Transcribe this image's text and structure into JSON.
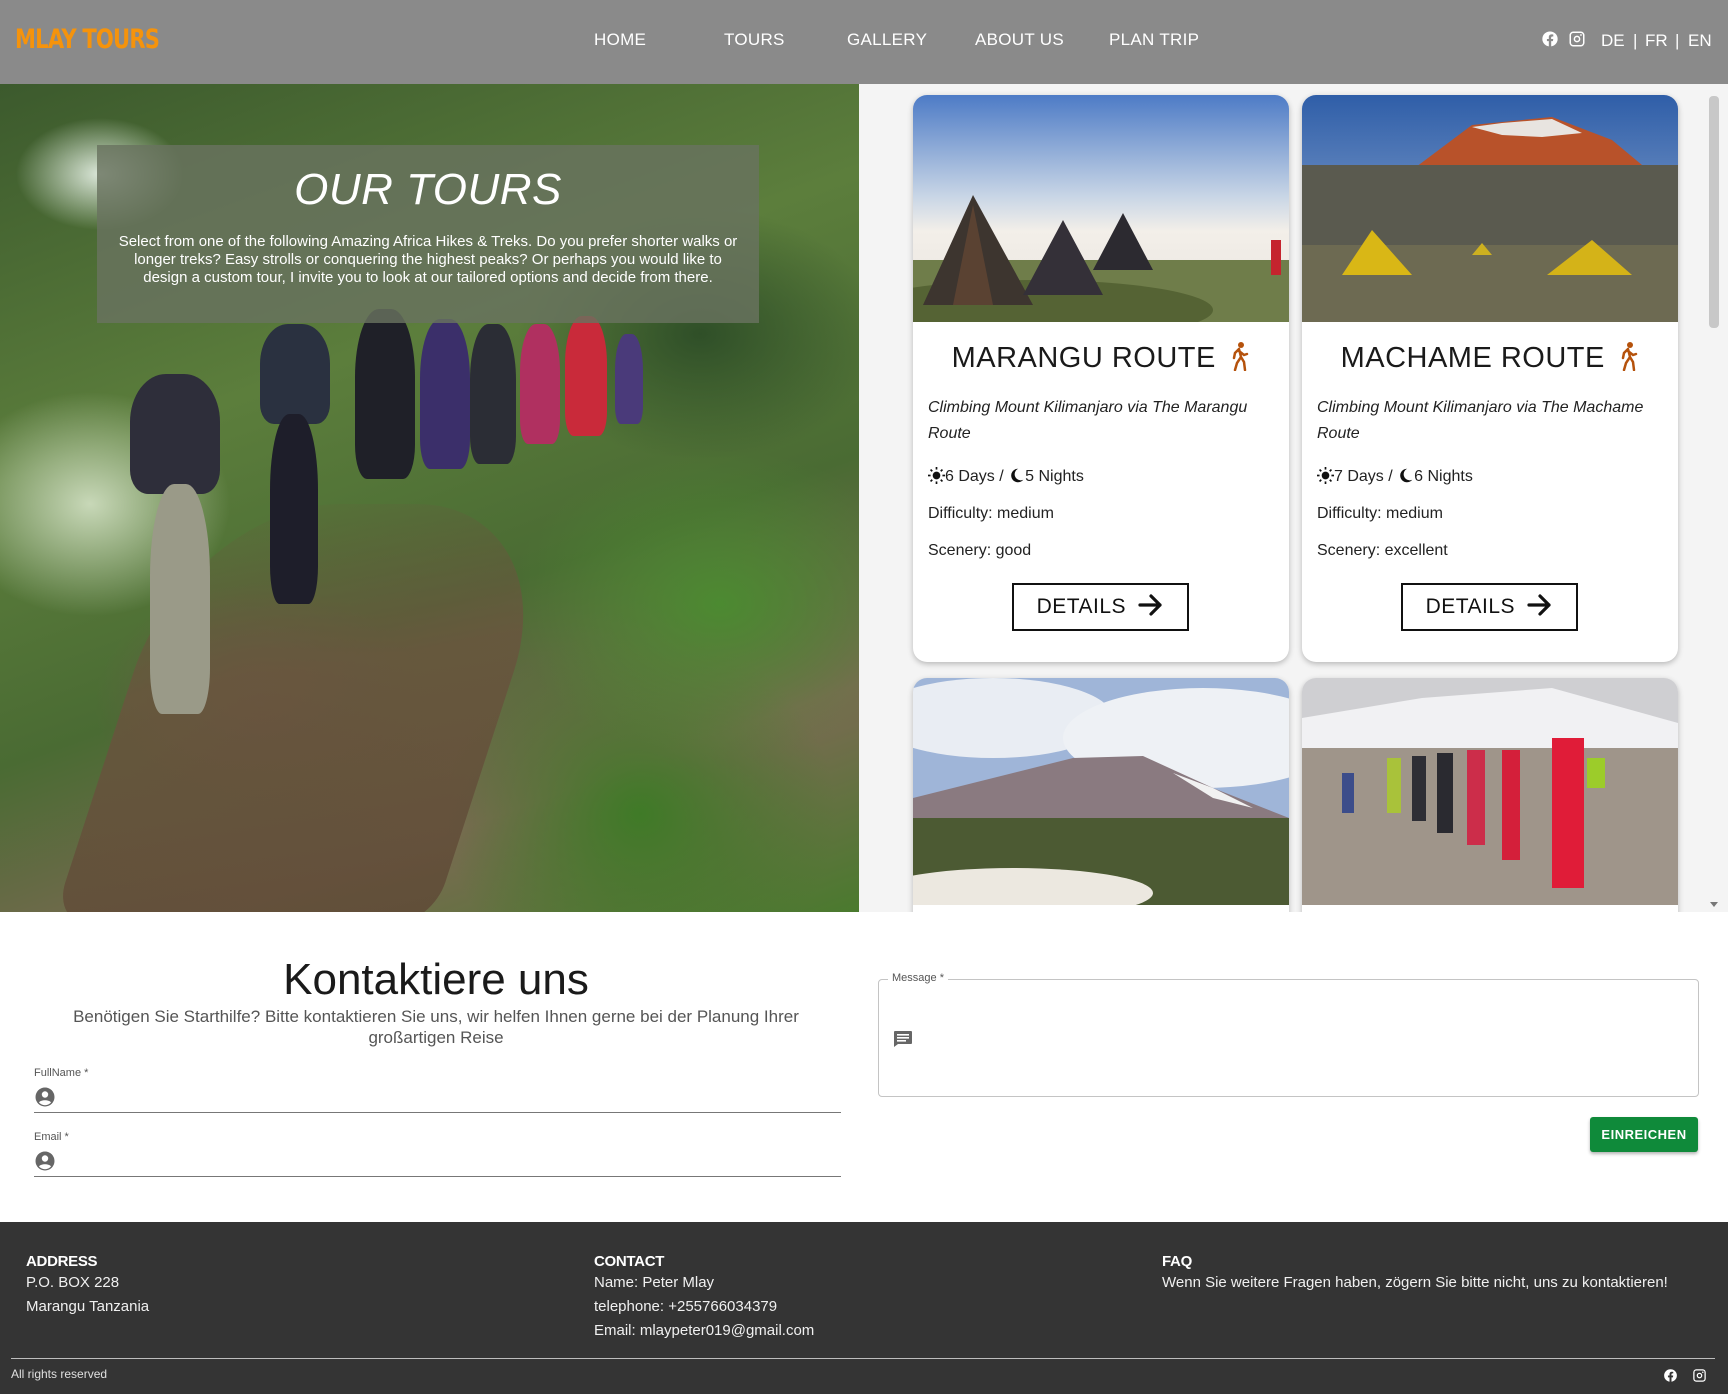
{
  "brand": {
    "name": "MLAY TOURS",
    "color": "#f5930c"
  },
  "nav": {
    "links": [
      "HOME",
      "TOURS",
      "GALLERY",
      "ABOUT US",
      "PLAN TRIP"
    ],
    "social_icons": [
      "facebook-icon",
      "instagram-icon"
    ],
    "languages": [
      "DE",
      "FR",
      "EN"
    ],
    "separator": "|"
  },
  "hero": {
    "title": "OUR TOURS",
    "text": "Select from one of the following Amazing Africa Hikes & Treks. Do you prefer shorter walks or longer treks? Easy strolls or conquering the highest peaks? Or perhaps you would like to design a custom tour, I invite you to look at our tailored options and decide from there."
  },
  "tours": [
    {
      "title": "MARANGU ROUTE",
      "subtitle": "Climbing Mount Kilimanjaro via The Marangu Route",
      "days": "6 Days /",
      "nights": "5 Nights",
      "difficulty": "Difficulty: medium",
      "scenery": "Scenery: good",
      "button": "DETAILS"
    },
    {
      "title": "MACHAME ROUTE",
      "subtitle": "Climbing Mount Kilimanjaro via The Machame Route",
      "days": "7 Days /",
      "nights": "6 Nights",
      "difficulty": "Difficulty: medium",
      "scenery": "Scenery: excellent",
      "button": "DETAILS"
    }
  ],
  "contact": {
    "title": "Kontaktiere uns",
    "subtitle": "Benötigen Sie Starthilfe? Bitte kontaktieren Sie uns, wir helfen Ihnen gerne bei der Planung Ihrer großartigen Reise",
    "fullname_label": "FullName *",
    "email_label": "Email *",
    "message_label": "Message *",
    "submit": "EINREICHEN",
    "submit_color": "#0f8a3a"
  },
  "footer": {
    "address_head": "ADDRESS",
    "address_lines": [
      "P.O. BOX 228",
      "Marangu Tanzania"
    ],
    "contact_head": "CONTACT",
    "contact_lines": [
      "Name: Peter Mlay",
      "telephone: +255766034379",
      "Email: mlaypeter019@gmail.com"
    ],
    "faq_head": "FAQ",
    "faq_text": "Wenn Sie weitere Fragen haben, zögern Sie bitte nicht, uns zu kontaktieren!",
    "rights": "All rights reserved",
    "background": "#343434"
  }
}
